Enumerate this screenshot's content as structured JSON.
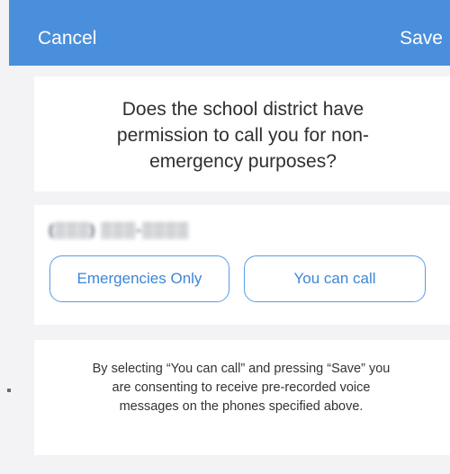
{
  "nav": {
    "cancel_label": "Cancel",
    "save_label": "Save"
  },
  "question": {
    "text": "Does the school district have permission to call you for non-emergency purposes?"
  },
  "phone": {
    "number": "(▒▒▒) ▒▒▒-▒▒▒▒",
    "options": [
      {
        "label": "Emergencies Only"
      },
      {
        "label": "You can call"
      }
    ]
  },
  "consent": {
    "text": "By selecting “You can call” and pressing “Save” you are consenting to receive pre-recorded voice messages on the phones specified above."
  },
  "colors": {
    "nav_background": "#4a8fdc",
    "accent": "#3d86d8",
    "page_background": "#f3f3f6",
    "card_background": "#ffffff"
  }
}
